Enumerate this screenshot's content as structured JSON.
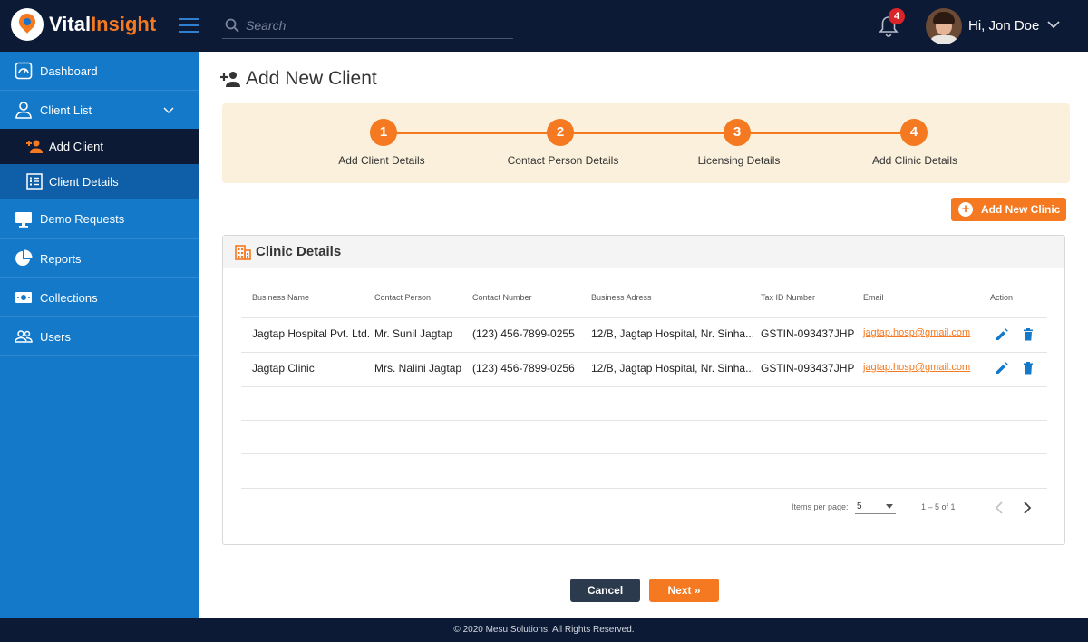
{
  "brand": {
    "name_part1": "Vital",
    "name_part2": "Insight"
  },
  "header": {
    "search_placeholder": "Search",
    "notification_count": "4",
    "greeting": "Hi, Jon Doe"
  },
  "sidebar": {
    "items": [
      {
        "label": "Dashboard",
        "icon": "speedometer-icon"
      },
      {
        "label": "Client List",
        "icon": "person-icon"
      },
      {
        "label": "Add Client",
        "icon": "add-person-icon"
      },
      {
        "label": "Client Details",
        "icon": "list-icon"
      },
      {
        "label": "Demo Requests",
        "icon": "monitor-icon"
      },
      {
        "label": "Reports",
        "icon": "pie-chart-icon"
      },
      {
        "label": "Collections",
        "icon": "money-icon"
      },
      {
        "label": "Users",
        "icon": "people-icon"
      }
    ]
  },
  "page": {
    "title": "Add New Client"
  },
  "stepper": {
    "steps": [
      {
        "num": "1",
        "label": "Add Client Details"
      },
      {
        "num": "2",
        "label": "Contact Person Details"
      },
      {
        "num": "3",
        "label": "Licensing Details"
      },
      {
        "num": "4",
        "label": "Add Clinic Details"
      }
    ]
  },
  "add_clinic_label": "Add New Clinic",
  "clinic": {
    "title": "Clinic Details",
    "columns": [
      "Business Name",
      "Contact Person",
      "Contact Number",
      "Business Adress",
      "Tax ID Number",
      "Email",
      "Action"
    ],
    "rows": [
      [
        "Jagtap Hospital Pvt. Ltd.",
        "Mr. Sunil Jagtap",
        "(123) 456-7899-0255",
        "12/B, Jagtap Hospital, Nr. Sinha...",
        "GSTIN-093437JHP",
        "jagtap.hosp@gmail.com"
      ],
      [
        "Jagtap Clinic",
        "Mrs. Nalini Jagtap",
        "(123) 456-7899-0256",
        "12/B, Jagtap Hospital, Nr. Sinha...",
        "GSTIN-093437JHP",
        "jagtap.hosp@gmail.com"
      ]
    ],
    "paginator": {
      "items_label": "Items per page:",
      "page_size": "5",
      "range": "1 – 5 of 1"
    }
  },
  "actions": {
    "cancel": "Cancel",
    "next": "Next »"
  },
  "footer": "© 2020 Mesu Solutions. All Rights Reserved.",
  "colors": {
    "accent": "#f47920",
    "sidebar": "#1479c9",
    "topbar": "#0c1a36"
  }
}
